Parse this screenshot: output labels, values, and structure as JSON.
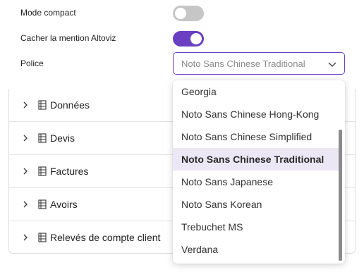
{
  "settings": {
    "compact_mode": {
      "label": "Mode compact",
      "state": "off"
    },
    "hide_mention": {
      "label": "Cacher la mention Altoviz",
      "state": "on"
    },
    "font": {
      "label": "Police",
      "value": "Noto Sans Chinese Traditional"
    }
  },
  "sections": [
    {
      "label": "Données"
    },
    {
      "label": "Devis"
    },
    {
      "label": "Factures"
    },
    {
      "label": "Avoirs"
    },
    {
      "label": "Relevés de compte client"
    }
  ],
  "dropdown": {
    "options": [
      "Georgia",
      "Noto Sans Chinese Hong-Kong",
      "Noto Sans Chinese Simplified",
      "Noto Sans Chinese Traditional",
      "Noto Sans Japanese",
      "Noto Sans Korean",
      "Trebuchet MS",
      "Verdana"
    ],
    "selected": "Noto Sans Chinese Traditional"
  },
  "colors": {
    "accent": "#6a3fc2",
    "selected_bg": "#ece7f5",
    "toggle_off": "#c6c6c6"
  }
}
